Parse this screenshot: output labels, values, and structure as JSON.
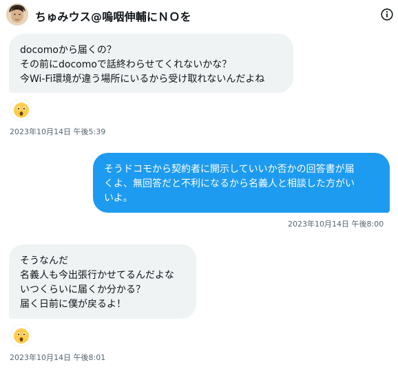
{
  "header": {
    "title": "ちゅみウス@嗚咽伸輔にＮＯを"
  },
  "messages": [
    {
      "direction": "incoming",
      "lines": [
        "docomoから届くの？",
        "その前にdocomoで話終わらせてくれないかな？",
        "今Wi-Fi環境が違う場所にいるから受け取れないんだよね"
      ],
      "reaction": "astonished-face",
      "timestamp": "2023年10月14日 午後5:39"
    },
    {
      "direction": "outgoing",
      "lines": [
        "そうドコモから契約者に開示していいか否かの回答書が届",
        "くよ、無回答だと不利になるから名義人と相談した方がい",
        "いよ。"
      ],
      "timestamp": "2023年10月14日 午後8:00"
    },
    {
      "direction": "incoming",
      "lines": [
        "そうなんだ",
        "名義人も今出張行かせてるんだよな",
        "いつくらいに届くか分かる？",
        "届く日前に僕が戻るよ！"
      ],
      "reaction": "astonished-face",
      "timestamp": "2023年10月14日 午後8:01"
    }
  ],
  "colors": {
    "outgoing_bubble": "#1d9bf0",
    "incoming_bubble": "#eff3f4",
    "timestamp": "#536471"
  }
}
